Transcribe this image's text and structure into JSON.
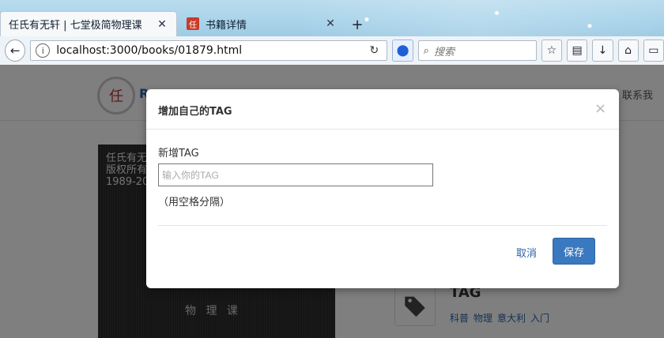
{
  "browser": {
    "tabs": [
      {
        "title": "任氏有无轩 | 七堂极简物理课",
        "active": true
      },
      {
        "title": "书籍详情",
        "favicon_text": "任",
        "active": false
      }
    ],
    "address_bar": {
      "url": "localhost:3000/books/01879.html"
    },
    "search": {
      "placeholder": "搜索"
    },
    "toolbar_icons": [
      "back-icon",
      "info-icon",
      "reload-icon",
      "bookmark-icon",
      "star-icon",
      "reader-icon",
      "download-icon",
      "home-icon",
      "sidebar-icon"
    ]
  },
  "page": {
    "header": {
      "logo_text": "任",
      "brand_partial": "R",
      "contact_label": "联系我"
    },
    "cover": {
      "text_lines": [
        "任氏有无",
        "版权所有",
        "1989-20"
      ],
      "subtitle": "物 理 课"
    },
    "tags": {
      "title": "TAG",
      "items": [
        "科普",
        "物理",
        "意大利",
        "入门"
      ]
    }
  },
  "modal": {
    "title": "增加自己的TAG",
    "close_symbol": "×",
    "field_label": "新增TAG",
    "input_placeholder": "输入你的TAG",
    "hint": "（用空格分隔）",
    "cancel_label": "取消",
    "save_label": "保存"
  },
  "colors": {
    "primary": "#3a78bf",
    "link": "#2a64a6",
    "backdrop": "rgba(0,0,0,0.5)"
  }
}
